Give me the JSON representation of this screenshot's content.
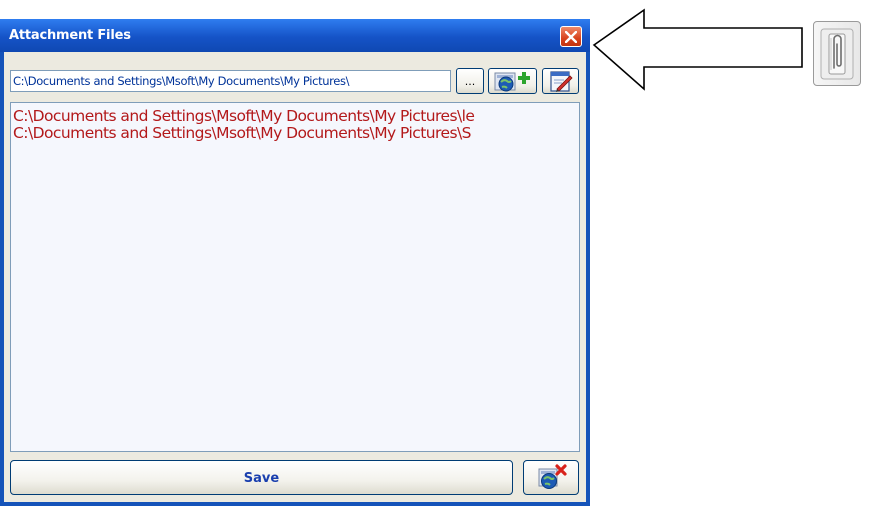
{
  "window": {
    "title": "Attachment Files"
  },
  "path_field": {
    "value": "C:\\Documents and Settings\\Msoft\\My Documents\\My Pictures\\"
  },
  "toolbar": {
    "browse_label": "..."
  },
  "file_list": {
    "items": [
      "C:\\Documents and Settings\\Msoft\\My Documents\\My Pictures\\le",
      "C:\\Documents and Settings\\Msoft\\My Documents\\My Pictures\\S"
    ]
  },
  "footer": {
    "save_label": "Save"
  },
  "colors": {
    "title_bar": "#1553c7",
    "client_bg": "#eceae0",
    "file_text": "#b3191b",
    "path_text": "#003399",
    "save_text": "#1a3fae"
  },
  "icons": {
    "close": "close-icon",
    "add": "globe-add-icon",
    "edit": "edit-document-icon",
    "remove": "globe-remove-icon",
    "attachment": "paperclip-icon"
  }
}
